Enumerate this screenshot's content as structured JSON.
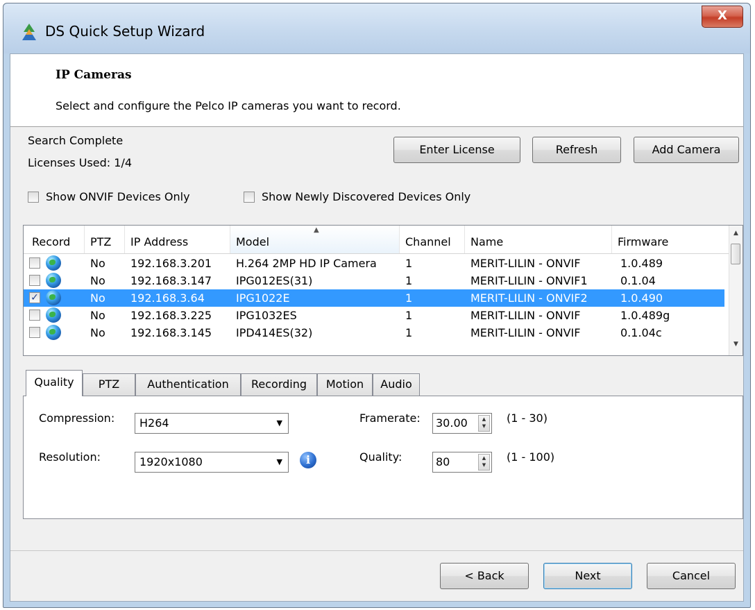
{
  "window": {
    "title": "DS Quick Setup Wizard",
    "close_glyph": "X"
  },
  "header": {
    "title": "IP Cameras",
    "description": "Select and configure the Pelco IP cameras you want to record."
  },
  "status": {
    "search": "Search Complete",
    "licenses": "Licenses Used: 1/4"
  },
  "toolbar": {
    "enter_license": "Enter License",
    "refresh": "Refresh",
    "add_camera": "Add Camera"
  },
  "filters": {
    "onvif_only": {
      "label": "Show ONVIF Devices Only",
      "checked": false
    },
    "newly_discovered_only": {
      "label": "Show Newly Discovered Devices Only",
      "checked": false
    }
  },
  "grid": {
    "columns": [
      "Record",
      "PTZ",
      "IP Address",
      "Model",
      "Channel",
      "Name",
      "Firmware"
    ],
    "sorted_column": "Model",
    "rows": [
      {
        "record": false,
        "ptz": "No",
        "ip": "192.168.3.201",
        "model": "H.264 2MP HD IP Camera",
        "channel": "1",
        "name": "MERIT-LILIN - ONVIF",
        "firmware": "1.0.489",
        "selected": false
      },
      {
        "record": false,
        "ptz": "No",
        "ip": "192.168.3.147",
        "model": "IPG012ES(31)",
        "channel": "1",
        "name": "MERIT-LILIN - ONVIF1",
        "firmware": "0.1.04",
        "selected": false
      },
      {
        "record": true,
        "ptz": "No",
        "ip": "192.168.3.64",
        "model": "IPG1022E",
        "channel": "1",
        "name": "MERIT-LILIN - ONVIF2",
        "firmware": "1.0.490",
        "selected": true
      },
      {
        "record": false,
        "ptz": "No",
        "ip": "192.168.3.225",
        "model": "IPG1032ES",
        "channel": "1",
        "name": "MERIT-LILIN - ONVIF",
        "firmware": "1.0.489g",
        "selected": false
      },
      {
        "record": false,
        "ptz": "No",
        "ip": "192.168.3.145",
        "model": "IPD414ES(32)",
        "channel": "1",
        "name": "MERIT-LILIN - ONVIF",
        "firmware": "0.1.04c",
        "selected": false
      }
    ]
  },
  "tabs": [
    {
      "label": "Quality",
      "active": true
    },
    {
      "label": "PTZ",
      "active": false
    },
    {
      "label": "Authentication",
      "active": false
    },
    {
      "label": "Recording",
      "active": false
    },
    {
      "label": "Motion",
      "active": false
    },
    {
      "label": "Audio",
      "active": false
    }
  ],
  "quality": {
    "compression_label": "Compression:",
    "compression_value": "H264",
    "resolution_label": "Resolution:",
    "resolution_value": "1920x1080",
    "framerate_label": "Framerate:",
    "framerate_value": "30.00",
    "framerate_range": "(1 - 30)",
    "quality_label": "Quality:",
    "quality_value": "80",
    "quality_range": "(1 - 100)"
  },
  "footer": {
    "back": "< Back",
    "next": "Next",
    "cancel": "Cancel"
  },
  "colors": {
    "selection": "#3399ff",
    "title_bar": "#c6d9ee",
    "close_button": "#c43e28"
  }
}
